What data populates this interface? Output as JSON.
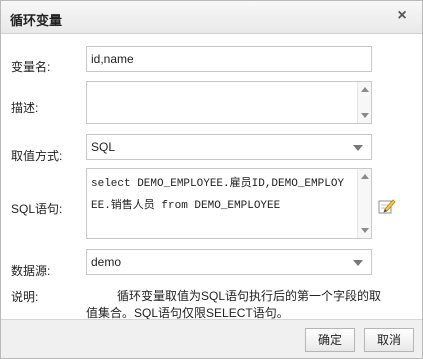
{
  "dialog": {
    "title": "循环变量",
    "close_icon": "close-icon"
  },
  "form": {
    "var_name": {
      "label": "变量名:",
      "value": "id,name"
    },
    "description": {
      "label": "描述:",
      "value": ""
    },
    "value_mode": {
      "label": "取值方式:",
      "selected": "SQL"
    },
    "sql": {
      "label": "SQL语句:",
      "value": "select DEMO_EMPLOYEE.雇员ID,DEMO_EMPLOYEE.销售人员 from DEMO_EMPLOYEE",
      "edit_icon": "edit-pencil-icon"
    },
    "datasource": {
      "label": "数据源:",
      "selected": "demo"
    },
    "note": {
      "label": "说明:",
      "text": "循环变量取值为SQL语句执行后的第一个字段的取值集合。SQL语句仅限SELECT语句。"
    }
  },
  "footer": {
    "ok_label": "确定",
    "cancel_label": "取消"
  },
  "colors": {
    "title_bg": "#ededed",
    "footer_bg": "#f0f0f0",
    "border": "#c8c8c8"
  }
}
